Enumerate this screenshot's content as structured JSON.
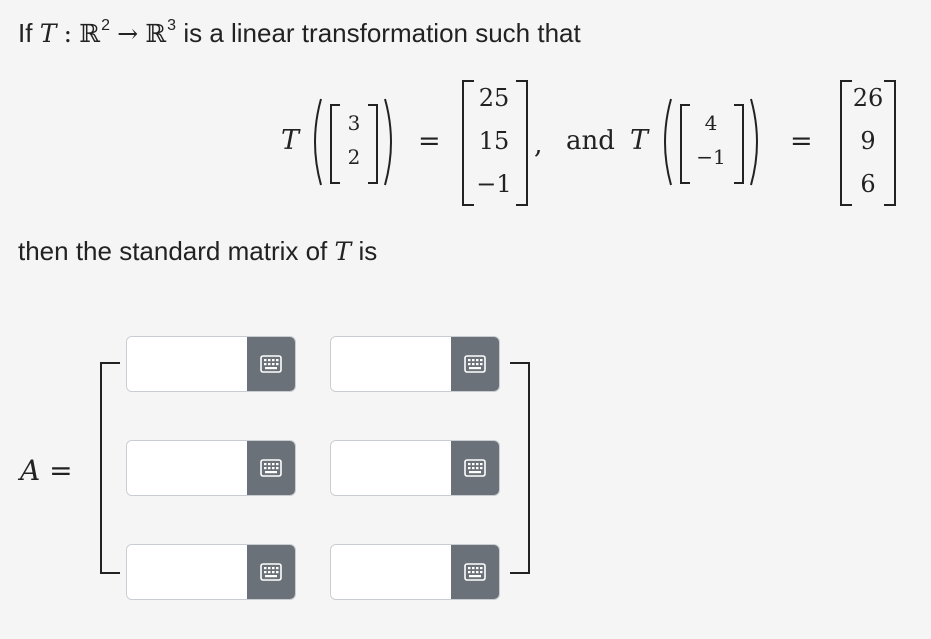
{
  "intro": {
    "prefix": "If",
    "T": "T",
    "colon": ":",
    "R": "ℝ",
    "exp_domain": "2",
    "arrow": "→",
    "exp_codomain": "3",
    "suffix": "is a linear transformation such that"
  },
  "equation": {
    "T": "T",
    "equals": "=",
    "comma": ",",
    "and": "and",
    "input1": [
      "3",
      "2"
    ],
    "output1": [
      "25",
      "15",
      "−1"
    ],
    "input2": [
      "4",
      "−1"
    ],
    "output2": [
      "26",
      "9",
      "6"
    ]
  },
  "prompt": {
    "prefix": "then the standard matrix of",
    "T": "T",
    "suffix": "is"
  },
  "matrix": {
    "label": "A",
    "equals": "=",
    "rows": [
      [
        {
          "value": "",
          "placeholder": ""
        },
        {
          "value": "",
          "placeholder": ""
        }
      ],
      [
        {
          "value": "",
          "placeholder": ""
        },
        {
          "value": "",
          "placeholder": ""
        }
      ],
      [
        {
          "value": "",
          "placeholder": ""
        },
        {
          "value": "",
          "placeholder": ""
        }
      ]
    ],
    "keypad_icon": "keypad-icon",
    "keypad_color": "#6b7178"
  }
}
